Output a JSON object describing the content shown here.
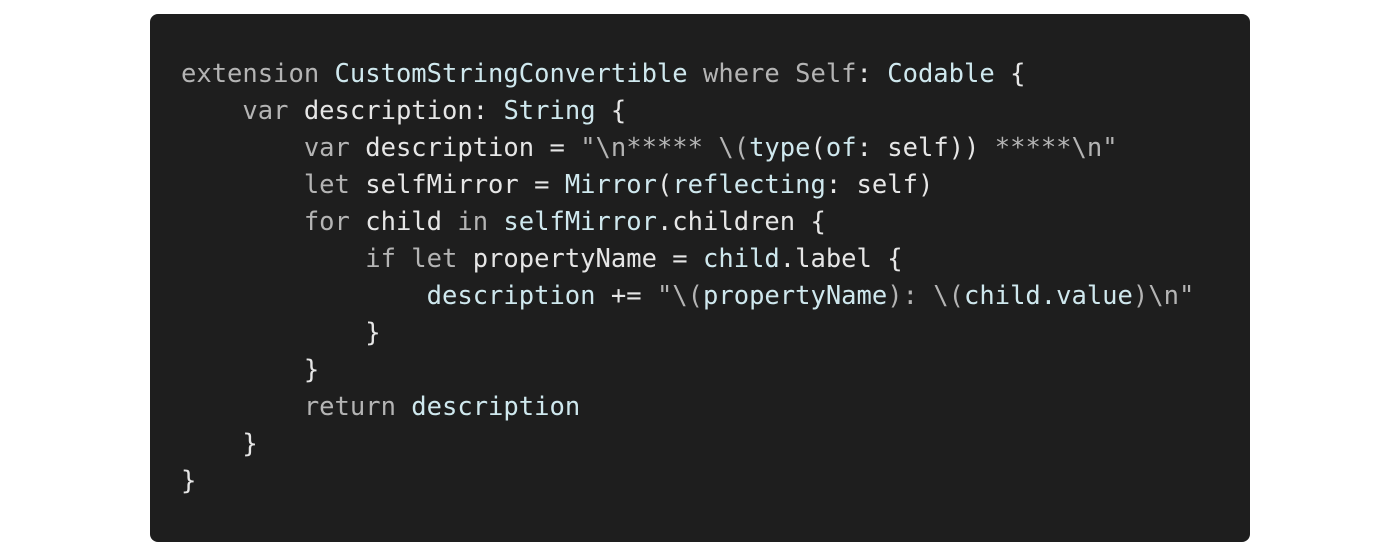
{
  "code": {
    "lines": [
      [
        {
          "t": "extension ",
          "k": "kw"
        },
        {
          "t": "CustomStringConvertible",
          "k": "type"
        },
        {
          "t": " where ",
          "k": "kw"
        },
        {
          "t": "Self",
          "k": "kw"
        },
        {
          "t": ": ",
          "k": "punct"
        },
        {
          "t": "Codable",
          "k": "type"
        },
        {
          "t": " {",
          "k": "punct"
        }
      ],
      [
        {
          "t": "    var ",
          "k": "kw"
        },
        {
          "t": "description",
          "k": "ident"
        },
        {
          "t": ": ",
          "k": "punct"
        },
        {
          "t": "String",
          "k": "type"
        },
        {
          "t": " {",
          "k": "punct"
        }
      ],
      [
        {
          "t": "        var ",
          "k": "kw"
        },
        {
          "t": "description",
          "k": "ident"
        },
        {
          "t": " = ",
          "k": "punct"
        },
        {
          "t": "\"\\n***** \\(",
          "k": "str"
        },
        {
          "t": "type",
          "k": "interp"
        },
        {
          "t": "(",
          "k": "punct"
        },
        {
          "t": "of",
          "k": "interp"
        },
        {
          "t": ": self",
          "k": "ident"
        },
        {
          "t": "))",
          "k": "punct"
        },
        {
          "t": " *****\\n\"",
          "k": "str"
        }
      ],
      [
        {
          "t": "        let ",
          "k": "kw"
        },
        {
          "t": "selfMirror",
          "k": "ident"
        },
        {
          "t": " = ",
          "k": "punct"
        },
        {
          "t": "Mirror",
          "k": "type"
        },
        {
          "t": "(",
          "k": "punct"
        },
        {
          "t": "reflecting",
          "k": "interp"
        },
        {
          "t": ": self)",
          "k": "ident"
        }
      ],
      [
        {
          "t": "        for ",
          "k": "kw"
        },
        {
          "t": "child ",
          "k": "ident"
        },
        {
          "t": "in ",
          "k": "kw"
        },
        {
          "t": "selfMirror",
          "k": "prop"
        },
        {
          "t": ".children {",
          "k": "ident"
        }
      ],
      [
        {
          "t": "            if let ",
          "k": "kw"
        },
        {
          "t": "propertyName",
          "k": "ident"
        },
        {
          "t": " = ",
          "k": "punct"
        },
        {
          "t": "child",
          "k": "prop"
        },
        {
          "t": ".label {",
          "k": "ident"
        }
      ],
      [
        {
          "t": "                ",
          "k": "punct"
        },
        {
          "t": "description",
          "k": "prop"
        },
        {
          "t": " += ",
          "k": "punct"
        },
        {
          "t": "\"\\(",
          "k": "str"
        },
        {
          "t": "propertyName",
          "k": "interp"
        },
        {
          "t": "): \\(",
          "k": "str"
        },
        {
          "t": "child.value",
          "k": "interp"
        },
        {
          "t": ")\\n\"",
          "k": "str"
        }
      ],
      [
        {
          "t": "            }",
          "k": "punct"
        }
      ],
      [
        {
          "t": "        }",
          "k": "punct"
        }
      ],
      [
        {
          "t": "        return ",
          "k": "kw"
        },
        {
          "t": "description",
          "k": "prop"
        }
      ],
      [
        {
          "t": "    }",
          "k": "punct"
        }
      ],
      [
        {
          "t": "}",
          "k": "punct"
        }
      ]
    ]
  }
}
